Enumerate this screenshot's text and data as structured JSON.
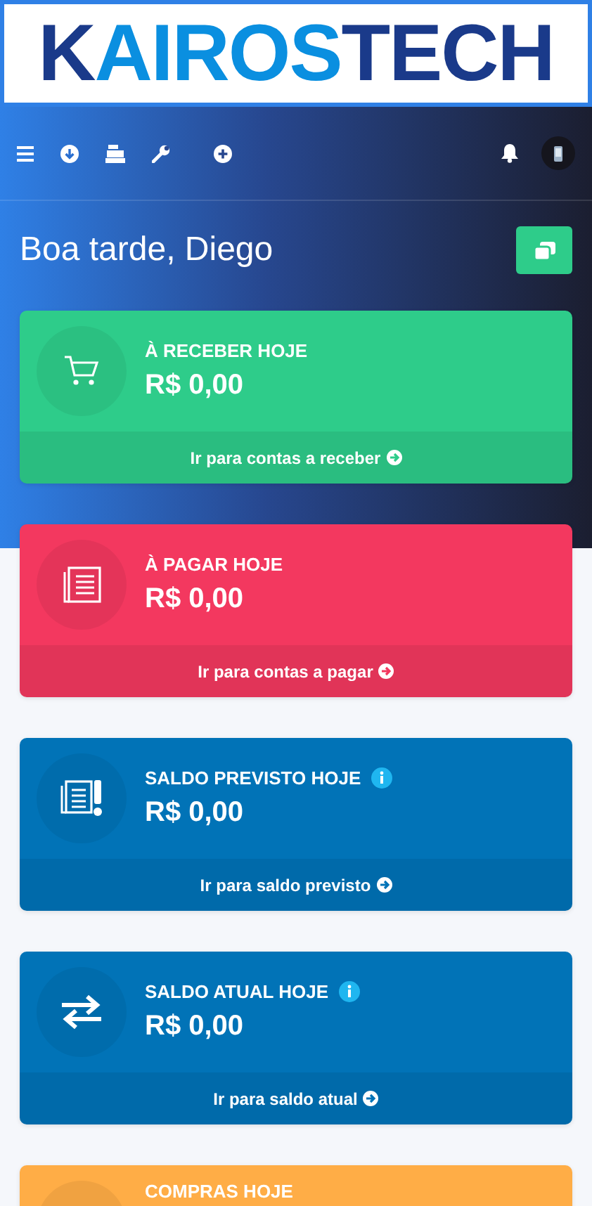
{
  "logo": {
    "parts": [
      {
        "text": "K",
        "kind": "dark"
      },
      {
        "text": "AIROS",
        "kind": "light"
      },
      {
        "text": "TECH",
        "kind": "dark"
      }
    ]
  },
  "greeting": "Boa tarde, Diego",
  "cards": [
    {
      "kind": "cart",
      "title": "À RECEBER HOJE",
      "info": false,
      "value": "R$ 0,00",
      "link": "Ir para contas a receber",
      "color": "#2ecc8a"
    },
    {
      "kind": "ledger",
      "title": "À PAGAR HOJE",
      "info": false,
      "value": "R$ 0,00",
      "link": "Ir para contas a pagar",
      "color": "#f3385f"
    },
    {
      "kind": "forecast",
      "title": "SALDO PREVISTO HOJE",
      "info": true,
      "value": "R$ 0,00",
      "link": "Ir para saldo previsto",
      "color": "#0173b7"
    },
    {
      "kind": "transfer",
      "title": "SALDO ATUAL HOJE",
      "info": true,
      "value": "R$ 0,00",
      "link": "Ir para saldo atual",
      "color": "#0173b7"
    },
    {
      "kind": "purchases",
      "title": "COMPRAS HOJE",
      "info": false,
      "color": "#ffad46"
    }
  ]
}
